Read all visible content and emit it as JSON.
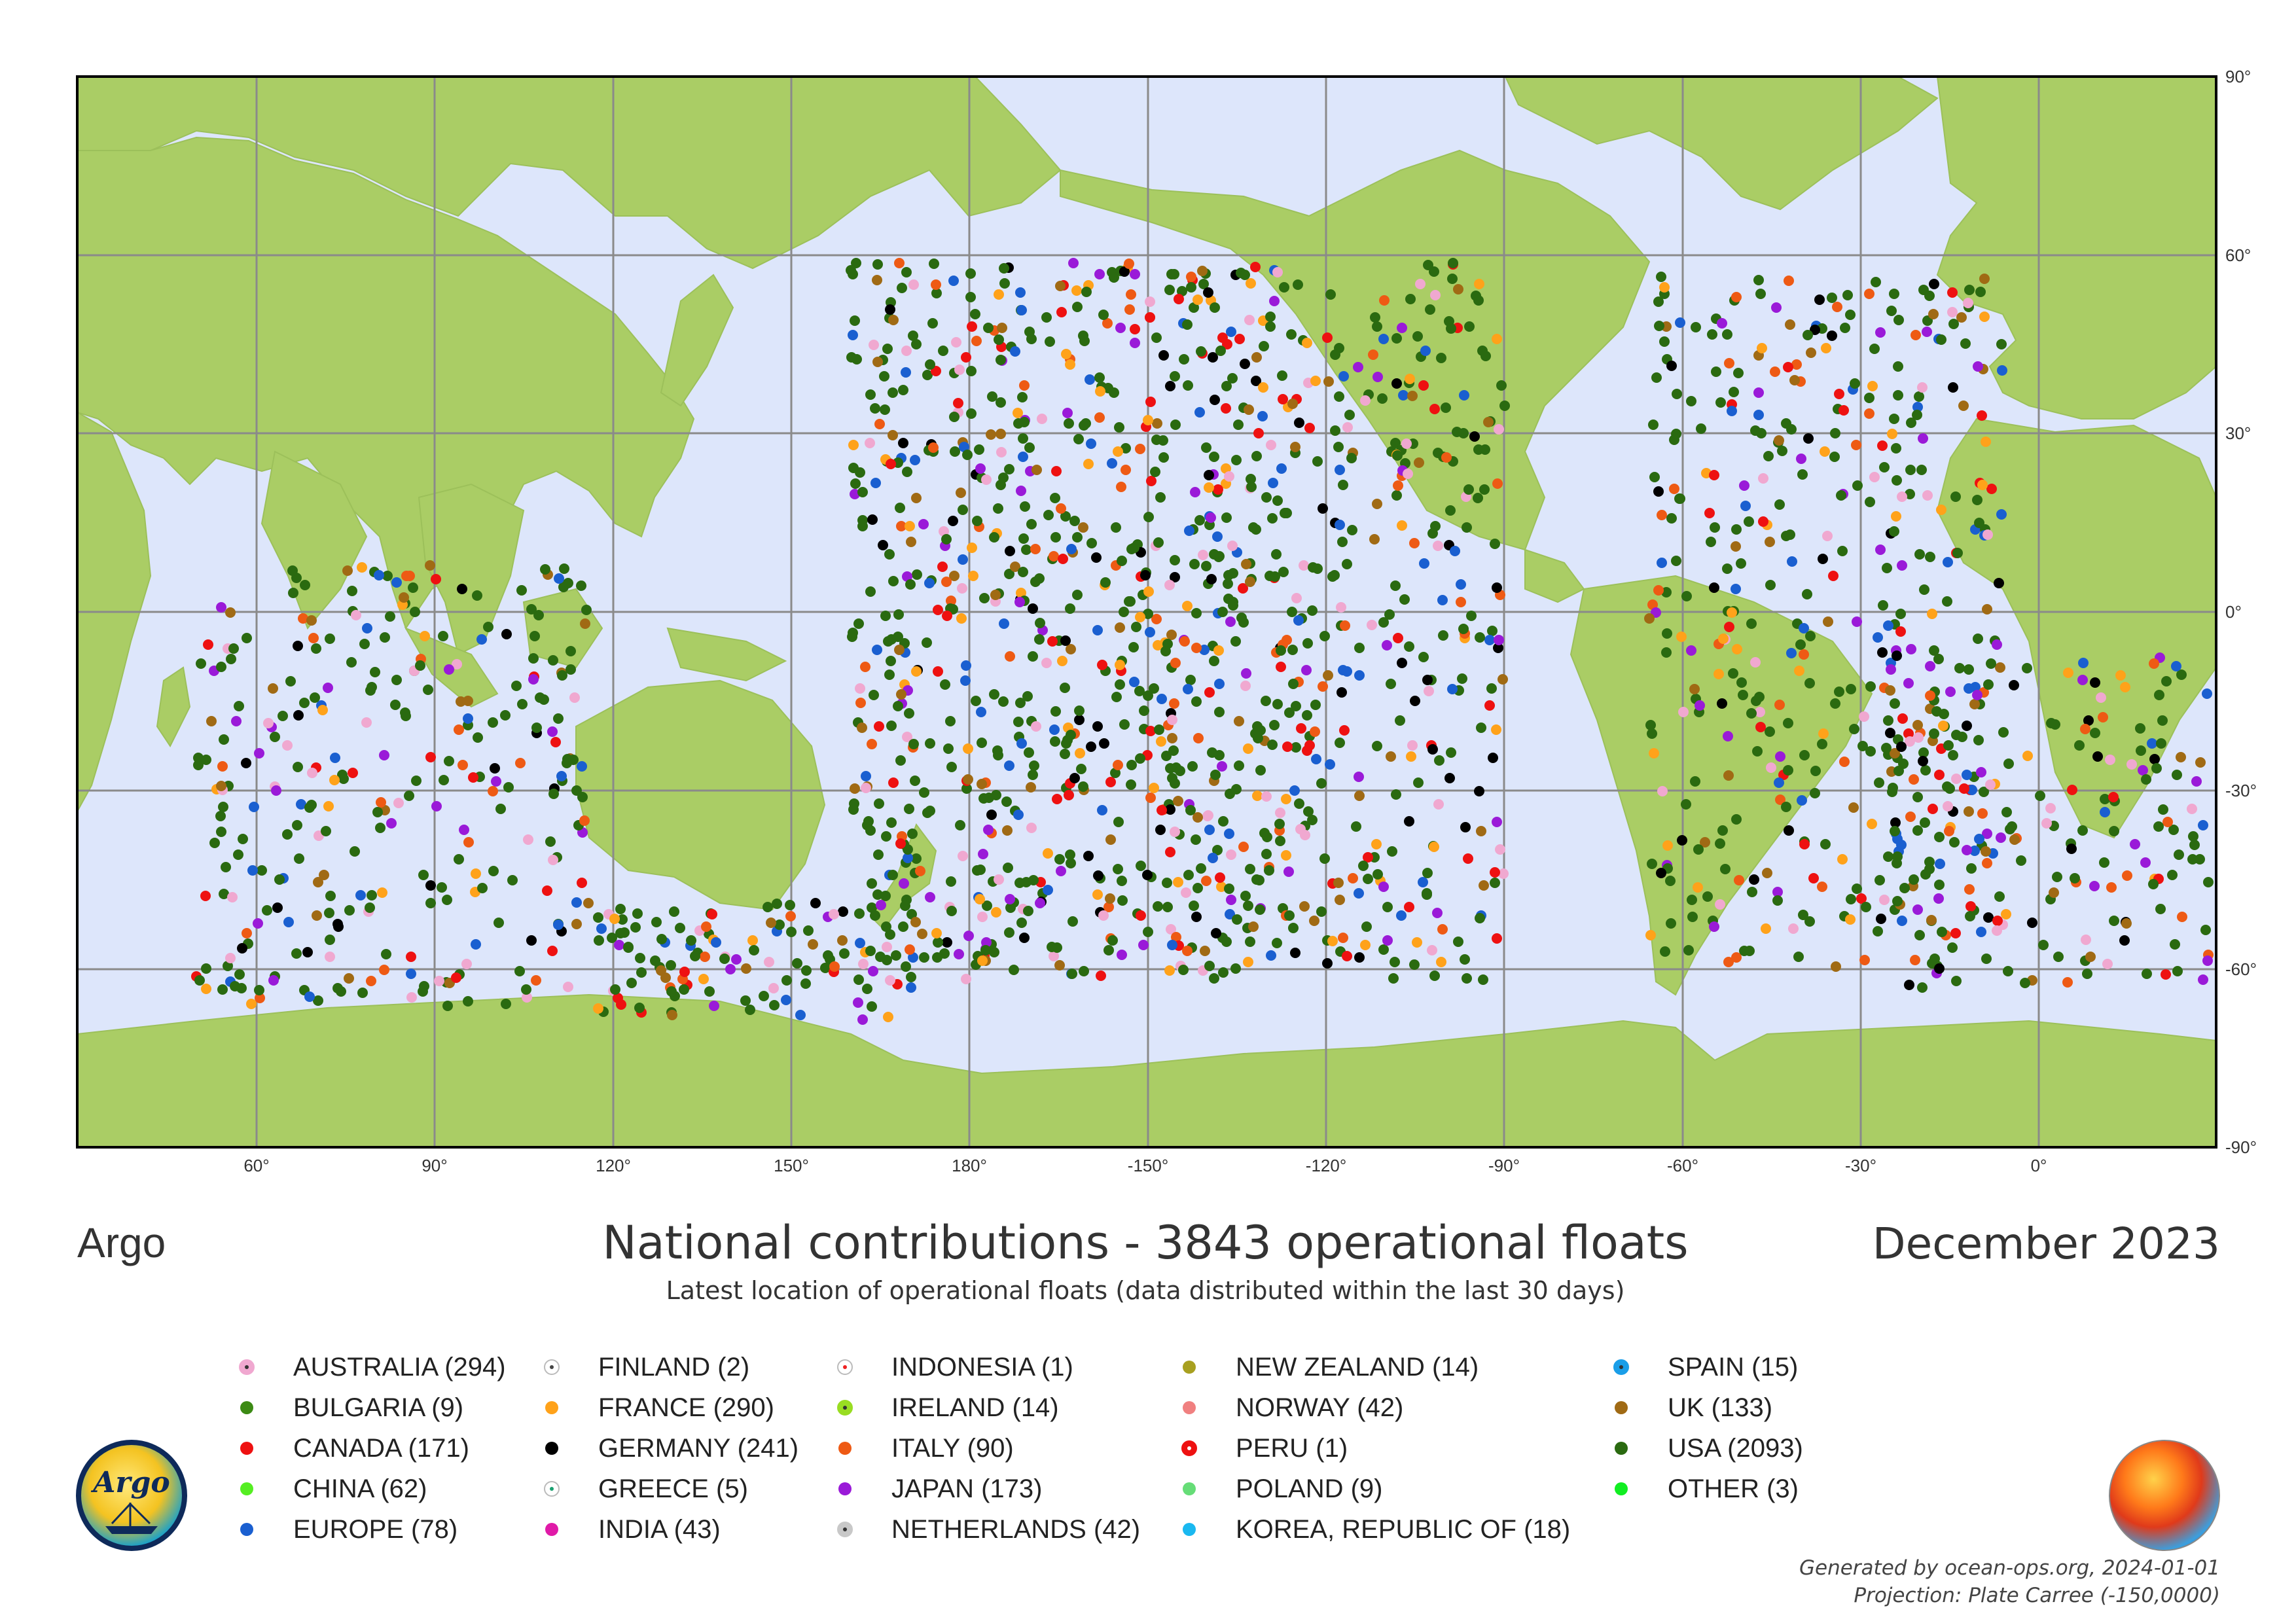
{
  "map": {
    "projection_center_lon": -150,
    "lon_ticks": [
      "60°",
      "90°",
      "120°",
      "150°",
      "180°",
      "-150°",
      "-120°",
      "-90°",
      "-60°",
      "-30°",
      "0°"
    ],
    "lat_ticks": [
      "90°",
      "60°",
      "30°",
      "0°",
      "-30°",
      "-60°",
      "-90°"
    ],
    "colors": {
      "ocean": "#dde6fb",
      "land": "#aacd65",
      "grid": "#8a8a8a",
      "frame": "#000000"
    }
  },
  "header": {
    "brand": "Argo",
    "title": "National contributions - 3843 operational floats",
    "subtitle": "Latest location of operational floats (data distributed within the last 30 days)",
    "date": "December 2023"
  },
  "legend": {
    "items": [
      {
        "label": "AUSTRALIA (294)",
        "style": "ring",
        "color": "#f0a8d0",
        "center": "#333333"
      },
      {
        "label": "BULGARIA (9)",
        "style": "dot",
        "color": "#3c8a14"
      },
      {
        "label": "CANADA (171)",
        "style": "dot",
        "color": "#ee1111"
      },
      {
        "label": "CHINA (62)",
        "style": "dot",
        "color": "#55ee22"
      },
      {
        "label": "EUROPE (78)",
        "style": "dot",
        "color": "#1a5fd0"
      },
      {
        "label": "FINLAND (2)",
        "style": "ring",
        "color": "#ffffff",
        "center": "#444444"
      },
      {
        "label": "FRANCE (290)",
        "style": "dot",
        "color": "#ffa21a"
      },
      {
        "label": "GERMANY (241)",
        "style": "dot",
        "color": "#000000"
      },
      {
        "label": "GREECE (5)",
        "style": "ring",
        "color": "#ffffff",
        "center": "#1aa070"
      },
      {
        "label": "INDIA (43)",
        "style": "dot",
        "color": "#e01aa8"
      },
      {
        "label": "INDONESIA (1)",
        "style": "ring",
        "color": "#ffffff",
        "center": "#ee2222"
      },
      {
        "label": "IRELAND (14)",
        "style": "ring",
        "color": "#99dd22",
        "center": "#333333"
      },
      {
        "label": "ITALY (90)",
        "style": "dot",
        "color": "#ee5a14"
      },
      {
        "label": "JAPAN (173)",
        "style": "dot",
        "color": "#9a1ad8"
      },
      {
        "label": "NETHERLANDS (42)",
        "style": "ring",
        "color": "#c8c8c8",
        "center": "#333333"
      },
      {
        "label": "NEW ZEALAND (14)",
        "style": "dot",
        "color": "#a8a020"
      },
      {
        "label": "NORWAY (42)",
        "style": "dot",
        "color": "#f08080"
      },
      {
        "label": "PERU (1)",
        "style": "ring",
        "color": "#ee1111",
        "center": "#ffffff"
      },
      {
        "label": "POLAND (9)",
        "style": "dot",
        "color": "#66dd77"
      },
      {
        "label": "KOREA, REPUBLIC OF (18)",
        "style": "dot",
        "color": "#1ab8f0"
      },
      {
        "label": "SPAIN (15)",
        "style": "ring",
        "color": "#1a9ee8",
        "center": "#333333"
      },
      {
        "label": "UK (133)",
        "style": "dot",
        "color": "#a06a14"
      },
      {
        "label": "USA (2093)",
        "style": "dot",
        "color": "#2a6a10"
      },
      {
        "label": "OTHER (3)",
        "style": "dot",
        "color": "#11ee22"
      }
    ]
  },
  "logo": {
    "text": "Argo"
  },
  "footer": {
    "generated": "Generated by ocean-ops.org, 2024-01-01",
    "projection": "Projection: Plate Carree (-150,0000)"
  }
}
